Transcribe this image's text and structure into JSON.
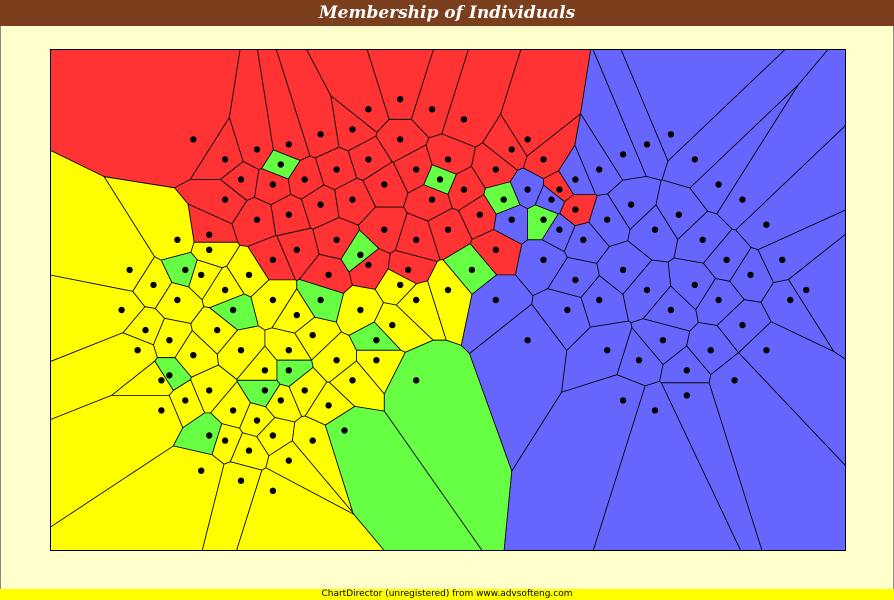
{
  "chart_data": {
    "type": "voronoi-scatter",
    "title": "Membership of Individuals",
    "xlabel": "",
    "ylabel": "",
    "axes_visible": false,
    "grid": false,
    "legend": "none",
    "groups": [
      {
        "color": "#ff3333",
        "region": "upper-left",
        "points": [
          [
            0.18,
            0.18
          ],
          [
            0.22,
            0.22
          ],
          [
            0.26,
            0.2
          ],
          [
            0.3,
            0.19
          ],
          [
            0.34,
            0.17
          ],
          [
            0.38,
            0.16
          ],
          [
            0.24,
            0.26
          ],
          [
            0.28,
            0.27
          ],
          [
            0.32,
            0.26
          ],
          [
            0.36,
            0.24
          ],
          [
            0.4,
            0.22
          ],
          [
            0.44,
            0.18
          ],
          [
            0.46,
            0.24
          ],
          [
            0.5,
            0.22
          ],
          [
            0.42,
            0.27
          ],
          [
            0.48,
            0.3
          ],
          [
            0.52,
            0.28
          ],
          [
            0.38,
            0.3
          ],
          [
            0.34,
            0.31
          ],
          [
            0.3,
            0.33
          ],
          [
            0.56,
            0.24
          ],
          [
            0.54,
            0.33
          ],
          [
            0.5,
            0.36
          ],
          [
            0.46,
            0.38
          ],
          [
            0.42,
            0.36
          ],
          [
            0.26,
            0.34
          ],
          [
            0.22,
            0.3
          ],
          [
            0.2,
            0.37
          ],
          [
            0.36,
            0.38
          ],
          [
            0.44,
            0.1
          ],
          [
            0.48,
            0.12
          ],
          [
            0.52,
            0.14
          ],
          [
            0.4,
            0.12
          ],
          [
            0.58,
            0.2
          ],
          [
            0.6,
            0.18
          ],
          [
            0.62,
            0.22
          ],
          [
            0.64,
            0.28
          ],
          [
            0.66,
            0.32
          ],
          [
            0.56,
            0.4
          ],
          [
            0.45,
            0.44
          ],
          [
            0.4,
            0.43
          ],
          [
            0.35,
            0.45
          ],
          [
            0.31,
            0.4
          ],
          [
            0.28,
            0.42
          ]
        ]
      },
      {
        "color": "#ffff00",
        "region": "lower-left",
        "points": [
          [
            0.1,
            0.44
          ],
          [
            0.13,
            0.47
          ],
          [
            0.16,
            0.5
          ],
          [
            0.19,
            0.45
          ],
          [
            0.22,
            0.48
          ],
          [
            0.25,
            0.45
          ],
          [
            0.28,
            0.5
          ],
          [
            0.31,
            0.53
          ],
          [
            0.12,
            0.56
          ],
          [
            0.15,
            0.58
          ],
          [
            0.18,
            0.61
          ],
          [
            0.21,
            0.56
          ],
          [
            0.24,
            0.6
          ],
          [
            0.27,
            0.64
          ],
          [
            0.3,
            0.6
          ],
          [
            0.33,
            0.57
          ],
          [
            0.36,
            0.62
          ],
          [
            0.14,
            0.66
          ],
          [
            0.17,
            0.7
          ],
          [
            0.2,
            0.68
          ],
          [
            0.23,
            0.72
          ],
          [
            0.26,
            0.74
          ],
          [
            0.29,
            0.7
          ],
          [
            0.32,
            0.68
          ],
          [
            0.35,
            0.71
          ],
          [
            0.38,
            0.66
          ],
          [
            0.41,
            0.62
          ],
          [
            0.22,
            0.78
          ],
          [
            0.25,
            0.8
          ],
          [
            0.28,
            0.77
          ],
          [
            0.3,
            0.82
          ],
          [
            0.33,
            0.78
          ],
          [
            0.19,
            0.84
          ],
          [
            0.24,
            0.86
          ],
          [
            0.28,
            0.88
          ],
          [
            0.09,
            0.52
          ],
          [
            0.11,
            0.6
          ],
          [
            0.16,
            0.38
          ],
          [
            0.2,
            0.4
          ],
          [
            0.39,
            0.52
          ],
          [
            0.43,
            0.55
          ],
          [
            0.46,
            0.5
          ],
          [
            0.5,
            0.48
          ],
          [
            0.44,
            0.47
          ],
          [
            0.14,
            0.72
          ]
        ]
      },
      {
        "color": "#66ff44",
        "region": "scattered",
        "points": [
          [
            0.17,
            0.44
          ],
          [
            0.23,
            0.52
          ],
          [
            0.27,
            0.68
          ],
          [
            0.34,
            0.5
          ],
          [
            0.41,
            0.58
          ],
          [
            0.46,
            0.66
          ],
          [
            0.3,
            0.64
          ],
          [
            0.37,
            0.76
          ],
          [
            0.53,
            0.44
          ],
          [
            0.57,
            0.3
          ],
          [
            0.62,
            0.34
          ],
          [
            0.2,
            0.77
          ],
          [
            0.15,
            0.65
          ],
          [
            0.39,
            0.41
          ],
          [
            0.49,
            0.26
          ],
          [
            0.29,
            0.23
          ]
        ]
      },
      {
        "color": "#6666ff",
        "region": "right",
        "points": [
          [
            0.6,
            0.28
          ],
          [
            0.63,
            0.3
          ],
          [
            0.66,
            0.26
          ],
          [
            0.69,
            0.24
          ],
          [
            0.72,
            0.21
          ],
          [
            0.75,
            0.19
          ],
          [
            0.78,
            0.17
          ],
          [
            0.81,
            0.22
          ],
          [
            0.84,
            0.27
          ],
          [
            0.87,
            0.3
          ],
          [
            0.9,
            0.35
          ],
          [
            0.64,
            0.36
          ],
          [
            0.67,
            0.38
          ],
          [
            0.7,
            0.34
          ],
          [
            0.73,
            0.31
          ],
          [
            0.76,
            0.36
          ],
          [
            0.79,
            0.33
          ],
          [
            0.82,
            0.38
          ],
          [
            0.85,
            0.42
          ],
          [
            0.88,
            0.45
          ],
          [
            0.66,
            0.46
          ],
          [
            0.69,
            0.5
          ],
          [
            0.72,
            0.44
          ],
          [
            0.75,
            0.48
          ],
          [
            0.78,
            0.52
          ],
          [
            0.81,
            0.47
          ],
          [
            0.84,
            0.5
          ],
          [
            0.87,
            0.55
          ],
          [
            0.9,
            0.6
          ],
          [
            0.93,
            0.5
          ],
          [
            0.7,
            0.6
          ],
          [
            0.74,
            0.62
          ],
          [
            0.77,
            0.58
          ],
          [
            0.8,
            0.64
          ],
          [
            0.83,
            0.6
          ],
          [
            0.86,
            0.66
          ],
          [
            0.72,
            0.7
          ],
          [
            0.76,
            0.72
          ],
          [
            0.8,
            0.69
          ],
          [
            0.58,
            0.34
          ],
          [
            0.62,
            0.42
          ],
          [
            0.65,
            0.52
          ],
          [
            0.56,
            0.5
          ],
          [
            0.6,
            0.58
          ],
          [
            0.92,
            0.42
          ],
          [
            0.95,
            0.48
          ]
        ]
      }
    ]
  },
  "footer_text": "ChartDirector (unregistered) from www.advsofteng.com"
}
